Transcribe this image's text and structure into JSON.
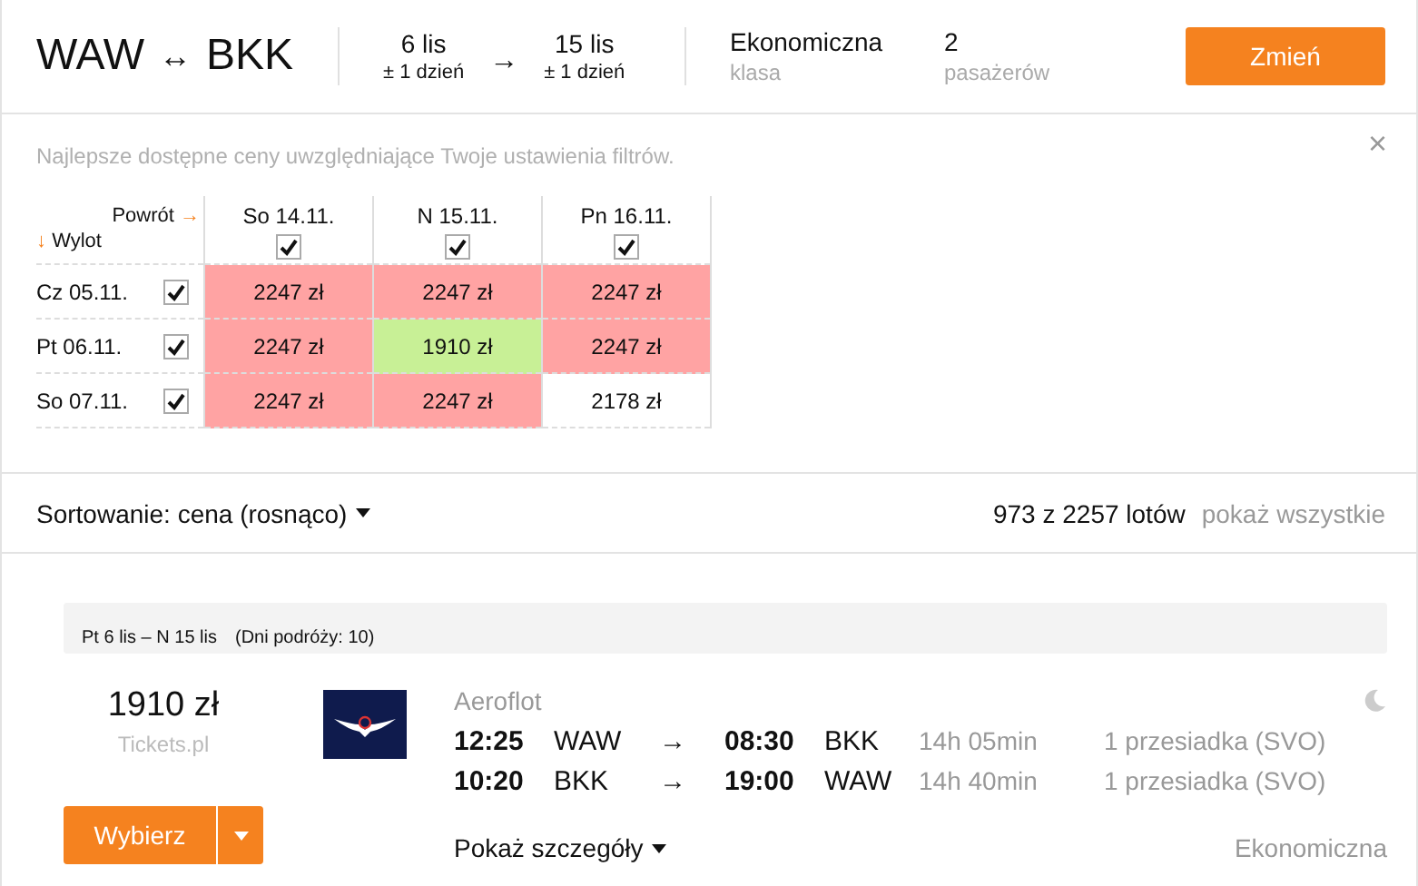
{
  "header": {
    "route": {
      "from": "WAW",
      "arrow": "↔",
      "to": "BKK"
    },
    "outbound": {
      "date": "6 lis",
      "flex": "± 1 dzień"
    },
    "dates_arrow": "→",
    "return": {
      "date": "15 lis",
      "flex": "± 1 dzień"
    },
    "class": {
      "value": "Ekonomiczna",
      "label": "klasa"
    },
    "passengers": {
      "value": "2",
      "label": "pasażerów"
    },
    "button": "Zmień"
  },
  "matrix": {
    "note": "Najlepsze dostępne ceny uwzględniające Twoje ustawienia filtrów.",
    "close": "×",
    "return_label": "Powrót",
    "return_arrow": "→",
    "depart_arrow": "↓",
    "depart_label": "Wylot",
    "columns": [
      {
        "label": "So 14.11.",
        "checked": true
      },
      {
        "label": "N 15.11.",
        "checked": true
      },
      {
        "label": "Pn 16.11.",
        "checked": true
      }
    ],
    "rows": [
      {
        "label": "Cz 05.11.",
        "checked": true,
        "cells": [
          {
            "price": "2247 zł",
            "kind": "expensive"
          },
          {
            "price": "2247 zł",
            "kind": "expensive"
          },
          {
            "price": "2247 zł",
            "kind": "expensive"
          }
        ]
      },
      {
        "label": "Pt 06.11.",
        "checked": true,
        "cells": [
          {
            "price": "2247 zł",
            "kind": "expensive"
          },
          {
            "price": "1910 zł",
            "kind": "cheapest"
          },
          {
            "price": "2247 zł",
            "kind": "expensive"
          }
        ]
      },
      {
        "label": "So 07.11.",
        "checked": true,
        "cells": [
          {
            "price": "2247 zł",
            "kind": "expensive"
          },
          {
            "price": "2247 zł",
            "kind": "expensive"
          },
          {
            "price": "2178 zł",
            "kind": "normal"
          }
        ]
      }
    ]
  },
  "sort": {
    "label": "Sortowanie: cena (rosnąco)",
    "count": "973 z 2257 lotów",
    "show_all": "pokaż wszystkie"
  },
  "result": {
    "dates": "Pt 6 lis – N 15 lis",
    "trip": "(Dni podróży: 10)",
    "price": "1910 zł",
    "vendor": "Tickets.pl",
    "button": "Wybierz",
    "airline": "Aeroflot",
    "legs": [
      {
        "dep": "12:25",
        "from": "WAW",
        "arrow": "→",
        "arr": "08:30",
        "to": "BKK",
        "duration": "14h 05min",
        "stops": "1 przesiadka (SVO)"
      },
      {
        "dep": "10:20",
        "from": "BKK",
        "arrow": "→",
        "arr": "19:00",
        "to": "WAW",
        "duration": "14h 40min",
        "stops": "1 przesiadka (SVO)"
      }
    ],
    "details": "Pokaż szczegóły",
    "class": "Ekonomiczna"
  }
}
